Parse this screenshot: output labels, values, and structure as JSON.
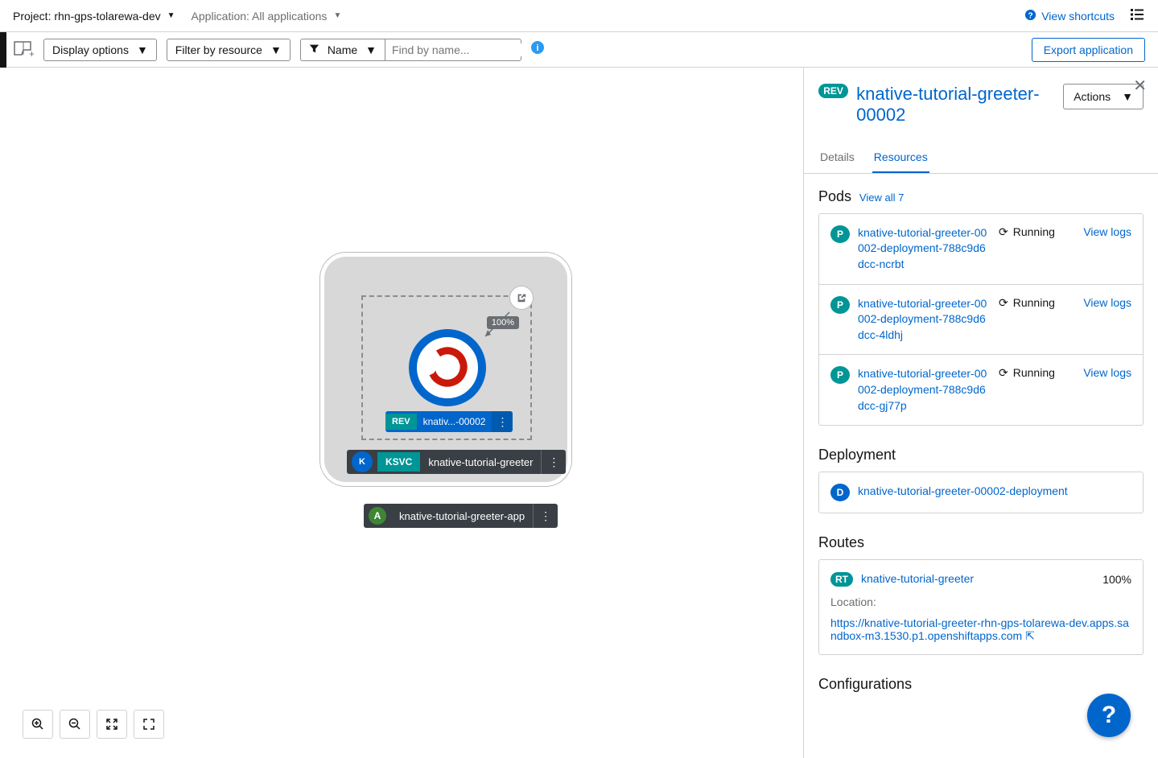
{
  "topbar": {
    "project_label": "Project: rhn-gps-tolarewa-dev",
    "app_label": "Application: All applications",
    "view_shortcuts": "View shortcuts"
  },
  "toolbar": {
    "display_options": "Display options",
    "filter_resource": "Filter by resource",
    "name": "Name",
    "search_placeholder": "Find by name...",
    "export": "Export application"
  },
  "topology": {
    "traffic": "100%",
    "rev_tag": "REV",
    "rev_name": "knativ...-00002",
    "ksvc_tag": "KSVC",
    "ksvc_name": "knative-tutorial-greeter",
    "app_tag": "A",
    "app_name": "knative-tutorial-greeter-app"
  },
  "panel": {
    "rev_tag": "REV",
    "title": "knative-tutorial-greeter-00002",
    "actions": "Actions",
    "tabs": {
      "details": "Details",
      "resources": "Resources"
    },
    "pods_heading": "Pods",
    "view_all": "View all 7",
    "pods": [
      {
        "name": "knative-tutorial-greeter-00002-deployment-788c9d6dcc-ncrbt",
        "status": "Running",
        "logs": "View logs"
      },
      {
        "name": "knative-tutorial-greeter-00002-deployment-788c9d6dcc-4ldhj",
        "status": "Running",
        "logs": "View logs"
      },
      {
        "name": "knative-tutorial-greeter-00002-deployment-788c9d6dcc-gj77p",
        "status": "Running",
        "logs": "View logs"
      }
    ],
    "deployment_heading": "Deployment",
    "deployment_name": "knative-tutorial-greeter-00002-deployment",
    "routes_heading": "Routes",
    "route_name": "knative-tutorial-greeter",
    "route_pct": "100%",
    "route_loc_label": "Location:",
    "route_url": "https://knative-tutorial-greeter-rhn-gps-tolarewa-dev.apps.sandbox-m3.1530.p1.openshiftapps.com",
    "config_heading": "Configurations"
  }
}
